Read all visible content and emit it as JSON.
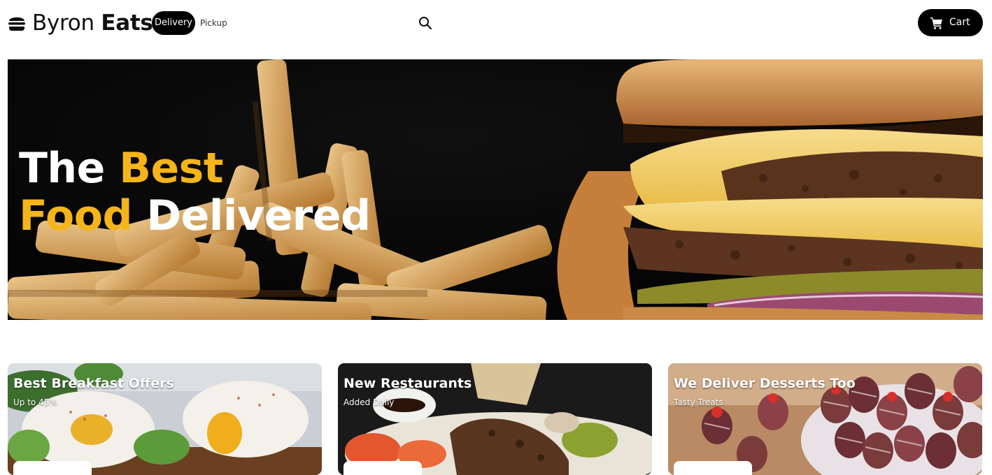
{
  "header": {
    "brand_light": "Byron",
    "brand_bold": "Eats",
    "delivery_label": "Delivery",
    "pickup_label": "Pickup",
    "cart_label": "Cart",
    "logo_icon": "burger-icon",
    "search_icon": "search-icon",
    "cart_icon": "cart-icon"
  },
  "hero": {
    "line1_white": "The",
    "line1_yellow": "Best",
    "line2_yellow": "Food",
    "line2_white": "Delivered"
  },
  "cards": [
    {
      "title": "Best Breakfast Offers",
      "subtitle": "Up to 45%"
    },
    {
      "title": "New Restaurants",
      "subtitle": "Added Daily"
    },
    {
      "title": "We Deliver Desserts Too",
      "subtitle": "Tasty Treats"
    }
  ],
  "colors": {
    "accent_yellow": "#f5b51a",
    "black": "#000000",
    "white": "#ffffff"
  }
}
